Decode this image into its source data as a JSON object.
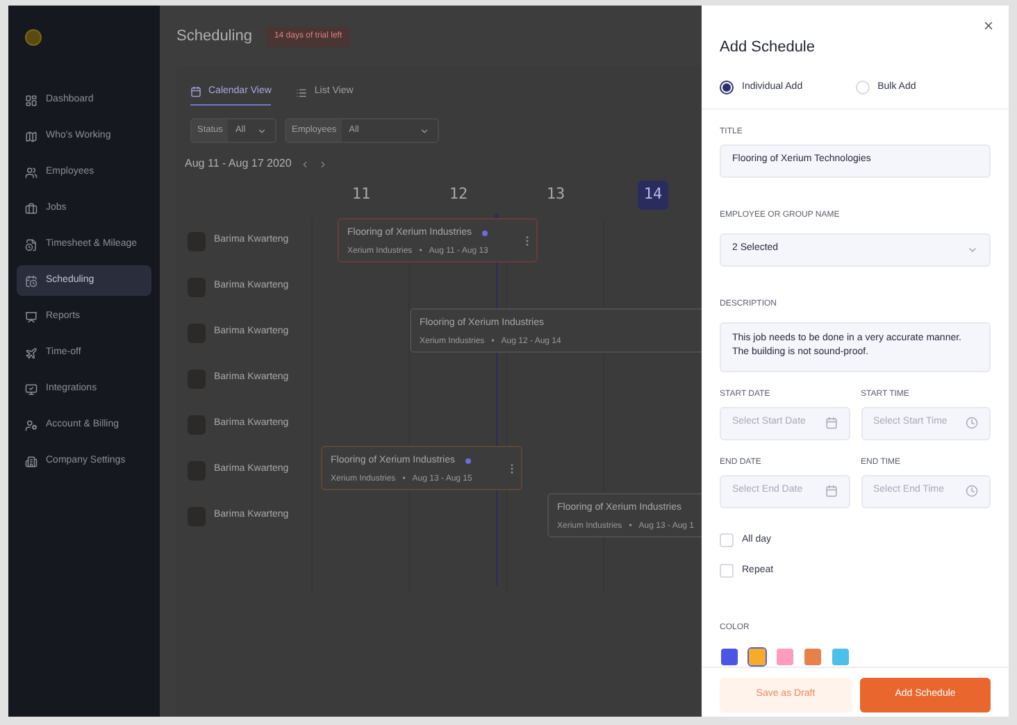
{
  "sidebar": {
    "items": [
      {
        "label": "Dashboard",
        "selected": false
      },
      {
        "label": "Who's Working",
        "selected": false
      },
      {
        "label": "Employees",
        "selected": false
      },
      {
        "label": "Jobs",
        "selected": false
      },
      {
        "label": "Timesheet & Mileage",
        "selected": false
      },
      {
        "label": "Scheduling",
        "selected": true
      },
      {
        "label": "Reports",
        "selected": false
      },
      {
        "label": "Time-off",
        "selected": false
      },
      {
        "label": "Integrations",
        "selected": false
      },
      {
        "label": "Account & Billing",
        "selected": false
      },
      {
        "label": "Company Settings",
        "selected": false
      }
    ]
  },
  "header": {
    "title": "Scheduling",
    "trial_badge": "14 days of trial left"
  },
  "view_tabs": [
    {
      "label": "Calendar View",
      "selected": true
    },
    {
      "label": "List View",
      "selected": false
    }
  ],
  "filters": [
    {
      "label": "Status",
      "value": "All"
    },
    {
      "label": "Employees",
      "value": "All"
    }
  ],
  "date_range": "Aug 11 - Aug 17 2020",
  "day_headers": [
    {
      "label": "11",
      "selected": false
    },
    {
      "label": "12",
      "selected": false
    },
    {
      "label": "13",
      "selected": false
    },
    {
      "label": "14",
      "selected": true
    }
  ],
  "employees": [
    {
      "name": "Barima Kwarteng"
    },
    {
      "name": "Barima Kwarteng"
    },
    {
      "name": "Barima Kwarteng"
    },
    {
      "name": "Barima Kwarteng"
    },
    {
      "name": "Barima Kwarteng"
    },
    {
      "name": "Barima Kwarteng"
    },
    {
      "name": "Barima Kwarteng"
    }
  ],
  "events": [
    {
      "title": "Flooring of Xerium Industries",
      "company": "Xerium Industries",
      "separator": "•",
      "dates": "Aug 11 - Aug 13",
      "marked": true,
      "color": "#6a3b3b"
    },
    {
      "title": "Flooring of Xerium Industries",
      "company": "Xerium Industries",
      "separator": "•",
      "dates": "Aug 12 - Aug 14",
      "marked": false,
      "color": "#4e4e52"
    },
    {
      "title": "Flooring of Xerium Industries",
      "company": "Xerium Industries",
      "separator": "•",
      "dates": "Aug 13 - Aug 15",
      "marked": true,
      "color": "#5e4636"
    },
    {
      "title": "Flooring of Xerium Industries",
      "company": "Xerium Industries",
      "separator": "•",
      "dates": "Aug 13 - Aug 1",
      "marked": false,
      "color": "#4e4e52"
    }
  ],
  "panel": {
    "title": "Add Schedule",
    "modes": [
      {
        "label": "Individual Add",
        "selected": true
      },
      {
        "label": "Bulk Add",
        "selected": false
      }
    ],
    "title_field": {
      "label": "TITLE",
      "value": "Flooring of Xerium Technologies"
    },
    "employee_field": {
      "label": "EMPLOYEE OR GROUP NAME",
      "value": "2 Selected"
    },
    "description_field": {
      "label": "DESCRIPTION",
      "value": "This job needs to be done in a very accurate manner. The building is not sound-proof."
    },
    "date_fields": [
      {
        "kind": "date",
        "label": "START DATE",
        "placeholder": "Select Start Date"
      },
      {
        "kind": "time",
        "label": "START TIME",
        "placeholder": "Select Start Time"
      },
      {
        "kind": "date",
        "label": "END DATE",
        "placeholder": "Select End Date"
      },
      {
        "kind": "time",
        "label": "END TIME",
        "placeholder": "Select End Time"
      }
    ],
    "checkboxes": [
      {
        "label": "All day",
        "checked": false
      },
      {
        "label": "Repeat",
        "checked": false
      }
    ],
    "color_label": "COLOR",
    "swatches": [
      {
        "color": "#4b55e3",
        "selected": false
      },
      {
        "color": "#f6ab2b",
        "selected": true
      },
      {
        "color": "#fd9cbd",
        "selected": false
      },
      {
        "color": "#e6814a",
        "selected": false
      },
      {
        "color": "#4cc0e9",
        "selected": false
      }
    ],
    "buttons": {
      "draft": "Save as Draft",
      "submit": "Add Schedule"
    }
  }
}
